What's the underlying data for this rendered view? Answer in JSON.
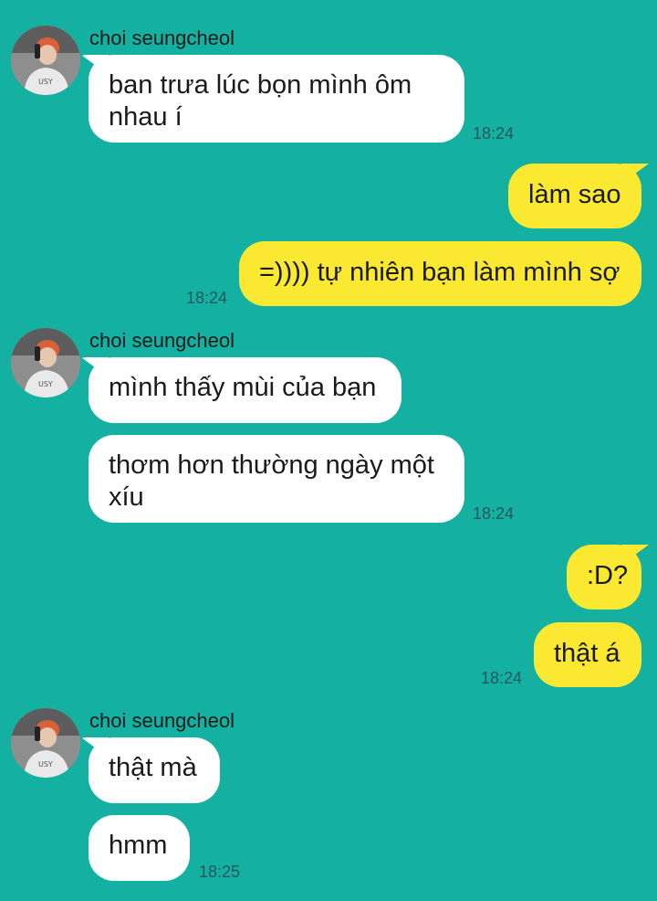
{
  "chat": {
    "contact_name": "choi seungcheol",
    "colors": {
      "background": "#14b1a3",
      "incoming_bubble": "#ffffff",
      "outgoing_bubble": "#fbe931",
      "timestamp": "#24595a"
    },
    "groups": [
      {
        "sender": "choi seungcheol",
        "messages": [
          {
            "text": "ban trưa lúc bọn mình ôm nhau í",
            "time": "18:24"
          }
        ]
      },
      {
        "sender": "me",
        "messages": [
          {
            "text": "làm sao"
          },
          {
            "text": "=)))) tự nhiên bạn làm mình sợ",
            "time": "18:24"
          }
        ]
      },
      {
        "sender": "choi seungcheol",
        "messages": [
          {
            "text": "mình thấy mùi của bạn"
          },
          {
            "text": "thơm hơn thường ngày một xíu",
            "time": "18:24"
          }
        ]
      },
      {
        "sender": "me",
        "messages": [
          {
            "text": ":D?"
          },
          {
            "text": "thật á",
            "time": "18:24"
          }
        ]
      },
      {
        "sender": "choi seungcheol",
        "messages": [
          {
            "text": "thật mà"
          },
          {
            "text": "hmm",
            "time": "18:25"
          }
        ]
      }
    ]
  }
}
